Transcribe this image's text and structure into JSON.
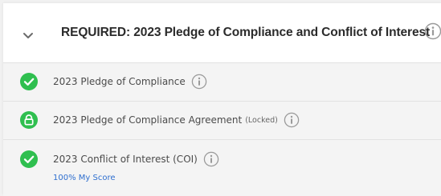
{
  "section": {
    "title": "REQUIRED: 2023 Pledge of Compliance and Conflict of Interest",
    "expanded_icon": "chevron-down-icon",
    "info_icon": "info-icon"
  },
  "items": [
    {
      "label": "2023 Pledge of Compliance",
      "status": "complete",
      "status_icon": "check-circle-icon"
    },
    {
      "label": "2023 Pledge of Compliance Agreement",
      "locked_text": "(Locked)",
      "status": "locked",
      "status_icon": "lock-icon"
    },
    {
      "label": "2023 Conflict of Interest (COI)",
      "status": "complete",
      "status_icon": "check-circle-icon",
      "score_text": "100% My Score"
    }
  ],
  "colors": {
    "success": "#2fbf4f",
    "link": "#2f6fcf"
  }
}
